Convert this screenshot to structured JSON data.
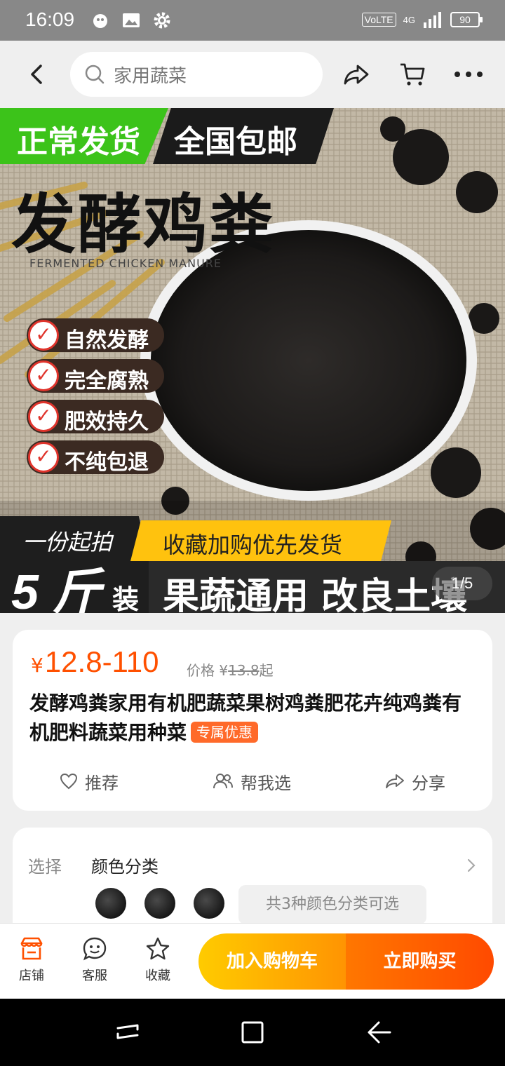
{
  "status_bar": {
    "time": "16:09",
    "network": "VoLTE",
    "signal": "4G",
    "battery": "90"
  },
  "nav": {
    "search_placeholder": "家用蔬菜"
  },
  "hero": {
    "badge_left": "正常发货",
    "badge_right": "全国包邮",
    "headline": "发酵鸡粪",
    "subline": "FERMENTED CHICKEN MANURE",
    "features": [
      "自然发酵",
      "完全腐熟",
      "肥效持久",
      "不纯包退"
    ],
    "min_order_label": "一份起拍",
    "min_order_value": "5 斤",
    "min_order_unit": "装",
    "promo_banner": "收藏加购优先发货",
    "tagline": "果蔬通用 改良土壤",
    "page_indicator": "1/5"
  },
  "product": {
    "currency": "¥",
    "price_range": "12.8-110",
    "orig_label": "价格",
    "orig_currency": "¥",
    "orig_price": "13.8",
    "orig_suffix": "起",
    "title": "发酵鸡粪家用有机肥蔬菜果树鸡粪肥花卉纯鸡粪有机肥料蔬菜用种菜",
    "tag": "专属优惠",
    "actions": {
      "recommend": "推荐",
      "help_choose": "帮我选",
      "share": "分享"
    }
  },
  "selection": {
    "label": "选择",
    "value": "颜色分类",
    "summary": "共3种颜色分类可选"
  },
  "bottom_bar": {
    "shop": "店铺",
    "service": "客服",
    "favorite": "收藏",
    "add_to_cart": "加入购物车",
    "buy_now": "立即购买"
  },
  "colors": {
    "accent": "#ff5000",
    "cart_btn": "#ffb300",
    "buy_btn": "#ff5a00",
    "hero_green": "#3cc31a"
  }
}
